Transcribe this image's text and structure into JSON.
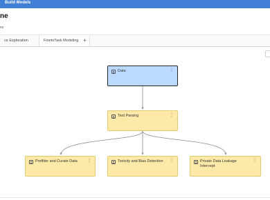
{
  "header": {
    "title": "Build Models"
  },
  "page": {
    "title": "ne",
    "subtitle": "es"
  },
  "tabs": [
    {
      "label": "ce Exploration"
    },
    {
      "label": "FinetoTask Modeling",
      "menu": "⋮"
    }
  ],
  "add_tab": "+",
  "nodes": {
    "data": {
      "label": "Data",
      "menu": "⋮"
    },
    "text_parsing": {
      "label": "Text Parsing",
      "menu": "⋮"
    },
    "prefilter": {
      "label": "Prefilter and Curate Data",
      "menu": "⋮"
    },
    "toxicity": {
      "label": "Toxicity and Bias Detection",
      "menu": "⋮"
    },
    "private_data": {
      "label": "Private Data Leakage Intercept",
      "menu": "⋮"
    }
  },
  "colors": {
    "header": "#3f7fd6",
    "selected_node": "#bcd9ff",
    "node": "#fde9a8"
  }
}
